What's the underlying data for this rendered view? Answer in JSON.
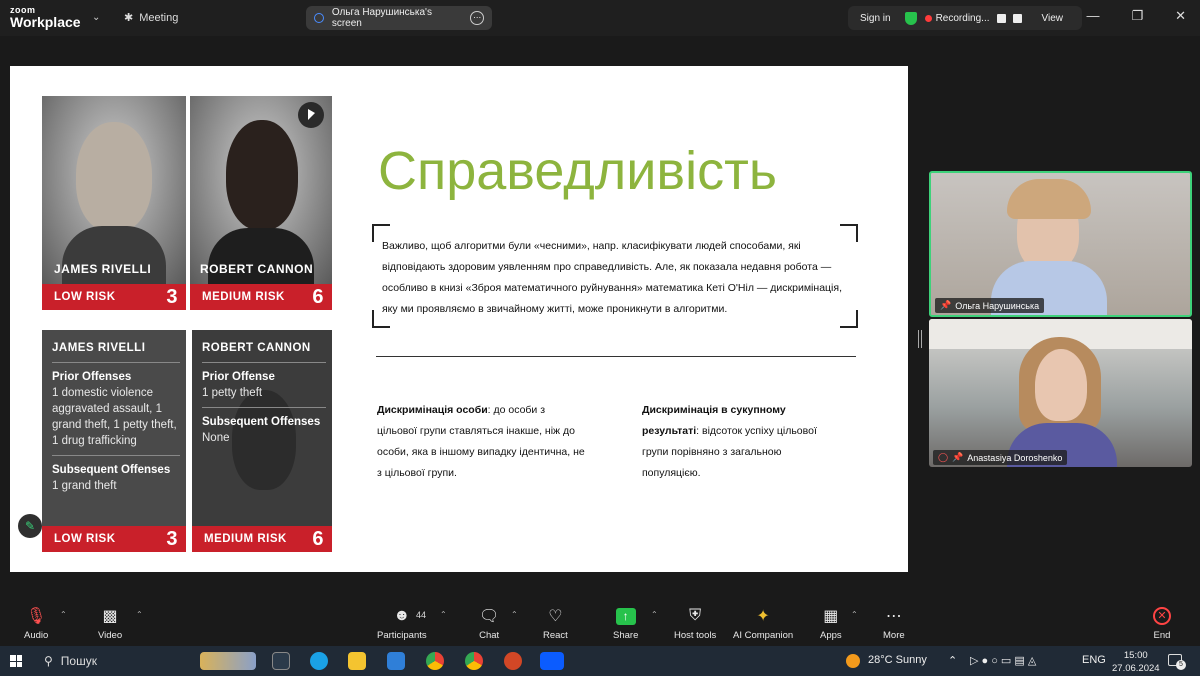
{
  "app": {
    "logo_top": "zoom",
    "logo_bottom": "Workplace",
    "meeting_label": "Meeting",
    "screen_owner": "Ольга Нарушинська's screen",
    "sign_in": "Sign in",
    "recording": "Recording...",
    "view": "View"
  },
  "slide": {
    "title": "Справедливість",
    "quote": "Важливо, щоб алгоритми були «чесними», напр. класифікувати людей способами, які відповідають здоровим уявленням про справедливість. Але, як показала недавня робота — особливо в книзі «Зброя математичного руйнування» математика Кеті О'Ніл — дискримінація, яку ми проявляємо в звичайному житті, може проникнути в алгоритми.",
    "col1_bold": "Дискримінація особи",
    "col1_text": ": до особи з цільової групи ставляться інакше, ніж до особи, яка в іншому випадку ідентична, не з цільової групи.",
    "col2_bold": "Дискримінація в сукупному результаті",
    "col2_text": ": відсоток успіху цільової групи порівняно з загальною популяцією."
  },
  "cards": {
    "top_left": {
      "name": "JAMES RIVELLI",
      "risk": "LOW RISK",
      "score": "3"
    },
    "top_right": {
      "name": "ROBERT CANNON",
      "risk": "MEDIUM RISK",
      "score": "6"
    },
    "bottom_left": {
      "name": "JAMES RIVELLI",
      "prior_h": "Prior Offenses",
      "prior": "1 domestic violence aggravated assault, 1 grand theft, 1 petty theft, 1 drug trafficking",
      "subs_h": "Subsequent Offenses",
      "subs": "1 grand theft",
      "risk": "LOW RISK",
      "score": "3"
    },
    "bottom_right": {
      "name": "ROBERT CANNON",
      "prior_h": "Prior Offense",
      "prior": "1 petty theft",
      "subs_h": "Subsequent Offenses",
      "subs": "None",
      "risk": "MEDIUM RISK",
      "score": "6"
    }
  },
  "videos": {
    "p1": "Ольга Нарушинська",
    "p2": "Anastasiya Doroshenko"
  },
  "toolbar": {
    "audio": "Audio",
    "video": "Video",
    "participants": "Participants",
    "participants_count": "44",
    "chat": "Chat",
    "react": "React",
    "share": "Share",
    "host_tools": "Host tools",
    "ai": "AI Companion",
    "apps": "Apps",
    "more": "More",
    "end": "End"
  },
  "taskbar": {
    "search": "Пошук",
    "weather": "28°C  Sunny",
    "lang": "ENG",
    "time": "15:00",
    "date": "27.06.2024",
    "notif_count": "5"
  },
  "colors": {
    "accent_green": "#8db43e",
    "risk_red": "#c9202a",
    "active_speaker": "#3ed27a"
  }
}
